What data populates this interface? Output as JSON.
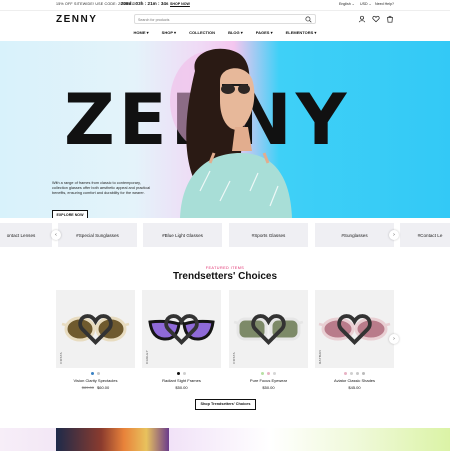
{
  "announce": {
    "promo": "15% OFF SITEWIDE! USE CODE: ZENNY15",
    "timer": "208d : 03h : 21m : 34s",
    "shop_now": "SHOP NOW",
    "language": "English",
    "currency": "USD",
    "help": "Need Help?"
  },
  "header": {
    "logo": "ZENNY",
    "search_placeholder": "Search for products"
  },
  "nav": {
    "items": [
      "HOME",
      "SHOP",
      "COLLECTION",
      "BLOG",
      "PAGES",
      "ELEMENTORS"
    ]
  },
  "hero": {
    "bigword": "ZENNY",
    "description": "With a range of frames from classic to contemporary, collection glasses offer both aesthetic appeal and practical benefits, ensuring comfort and durability for the wearer.",
    "cta": "EXPLORE NOW"
  },
  "tags": {
    "items": [
      "ontact Lenses",
      "#Special Sunglasses",
      "#Blue Light Glasses",
      "#Sports Glasses",
      "#Sunglasses",
      "#Contact Le"
    ]
  },
  "section": {
    "eyebrow": "FEATURED ITEMS",
    "title": "Trendsetters' Choices",
    "button": "Shop Trendsetters' Choices"
  },
  "products": [
    {
      "brand": "COSTA",
      "name": "Vision Clarity Spectacles",
      "old_price": "$89.00",
      "price": "$60.00",
      "lens": "#6f5a2e",
      "frame": "#e8dcc0",
      "swatches": [
        "#3b82c4",
        "#c9c9c9"
      ]
    },
    {
      "brand": "OAKLEY",
      "name": "Radiant Sight Frames",
      "old_price": "",
      "price": "$50.00",
      "lens": "#8f6ad8",
      "frame": "#151515",
      "swatches": [
        "#111111",
        "#d0d0d0"
      ]
    },
    {
      "brand": "COSTA",
      "name": "Pure Focus Eyewear",
      "old_price": "",
      "price": "$50.00",
      "lens": "#7d8a68",
      "frame": "#e6e6e6",
      "swatches": [
        "#b7e0a3",
        "#e8b2c4",
        "#d6d6d6"
      ]
    },
    {
      "brand": "RAYBAN",
      "name": "Aviator Classic Shades",
      "old_price": "",
      "price": "$45.00",
      "lens": "#b97b8a",
      "frame": "#e9cfd3",
      "swatches": [
        "#e8b2c4",
        "#d0d0d0",
        "#c9c9c9",
        "#bbbbbb"
      ]
    }
  ]
}
